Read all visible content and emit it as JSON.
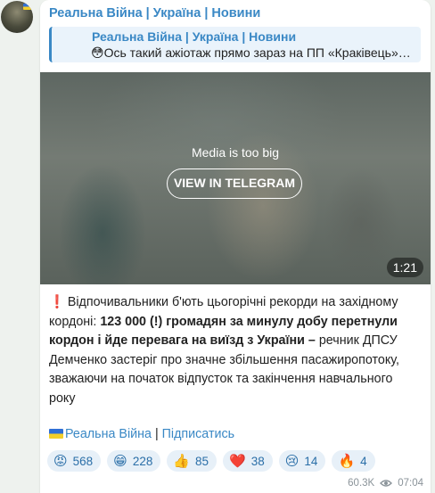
{
  "channel": {
    "name": "Реальна Війна | Україна | Новини"
  },
  "reply": {
    "name": "Реальна Війна | Україна | Новини",
    "text": "😳Ось такий ажіотаж прямо зараз на ПП «Краківець»…"
  },
  "media": {
    "message": "Media is too big",
    "button_label": "VIEW IN TELEGRAM",
    "duration": "1:21"
  },
  "post": {
    "excl": "❗",
    "p1": "Відпочивальники б'ють цьогорічні рекорди на західному кордоні: ",
    "bold": "123 000 (!) громадян за минулу добу перетнули кордон і йде перевага на виїзд з України –",
    "p2": " речник ДПСУ Демченко застеріг про значне збільшення пасажиропотоку, зважаючи на початок відпусток та закінчення навчального року"
  },
  "footer": {
    "channel_link": "Реальна Війна",
    "separator": " | ",
    "subscribe": "Підписатись"
  },
  "reactions": [
    {
      "emoji": "😡",
      "count": "568"
    },
    {
      "emoji": "😁",
      "count": "228"
    },
    {
      "emoji": "👍",
      "count": "85"
    },
    {
      "emoji": "❤️",
      "count": "38"
    },
    {
      "emoji": "😢",
      "count": "14"
    },
    {
      "emoji": "🔥",
      "count": "4"
    }
  ],
  "meta": {
    "views": "60.3K",
    "time": "07:04"
  },
  "colors": {
    "accent": "#3a88c5",
    "reaction_bg": "#e7f0f8",
    "bubble": "#ffffff",
    "chat_bg": "#eef2ee"
  }
}
